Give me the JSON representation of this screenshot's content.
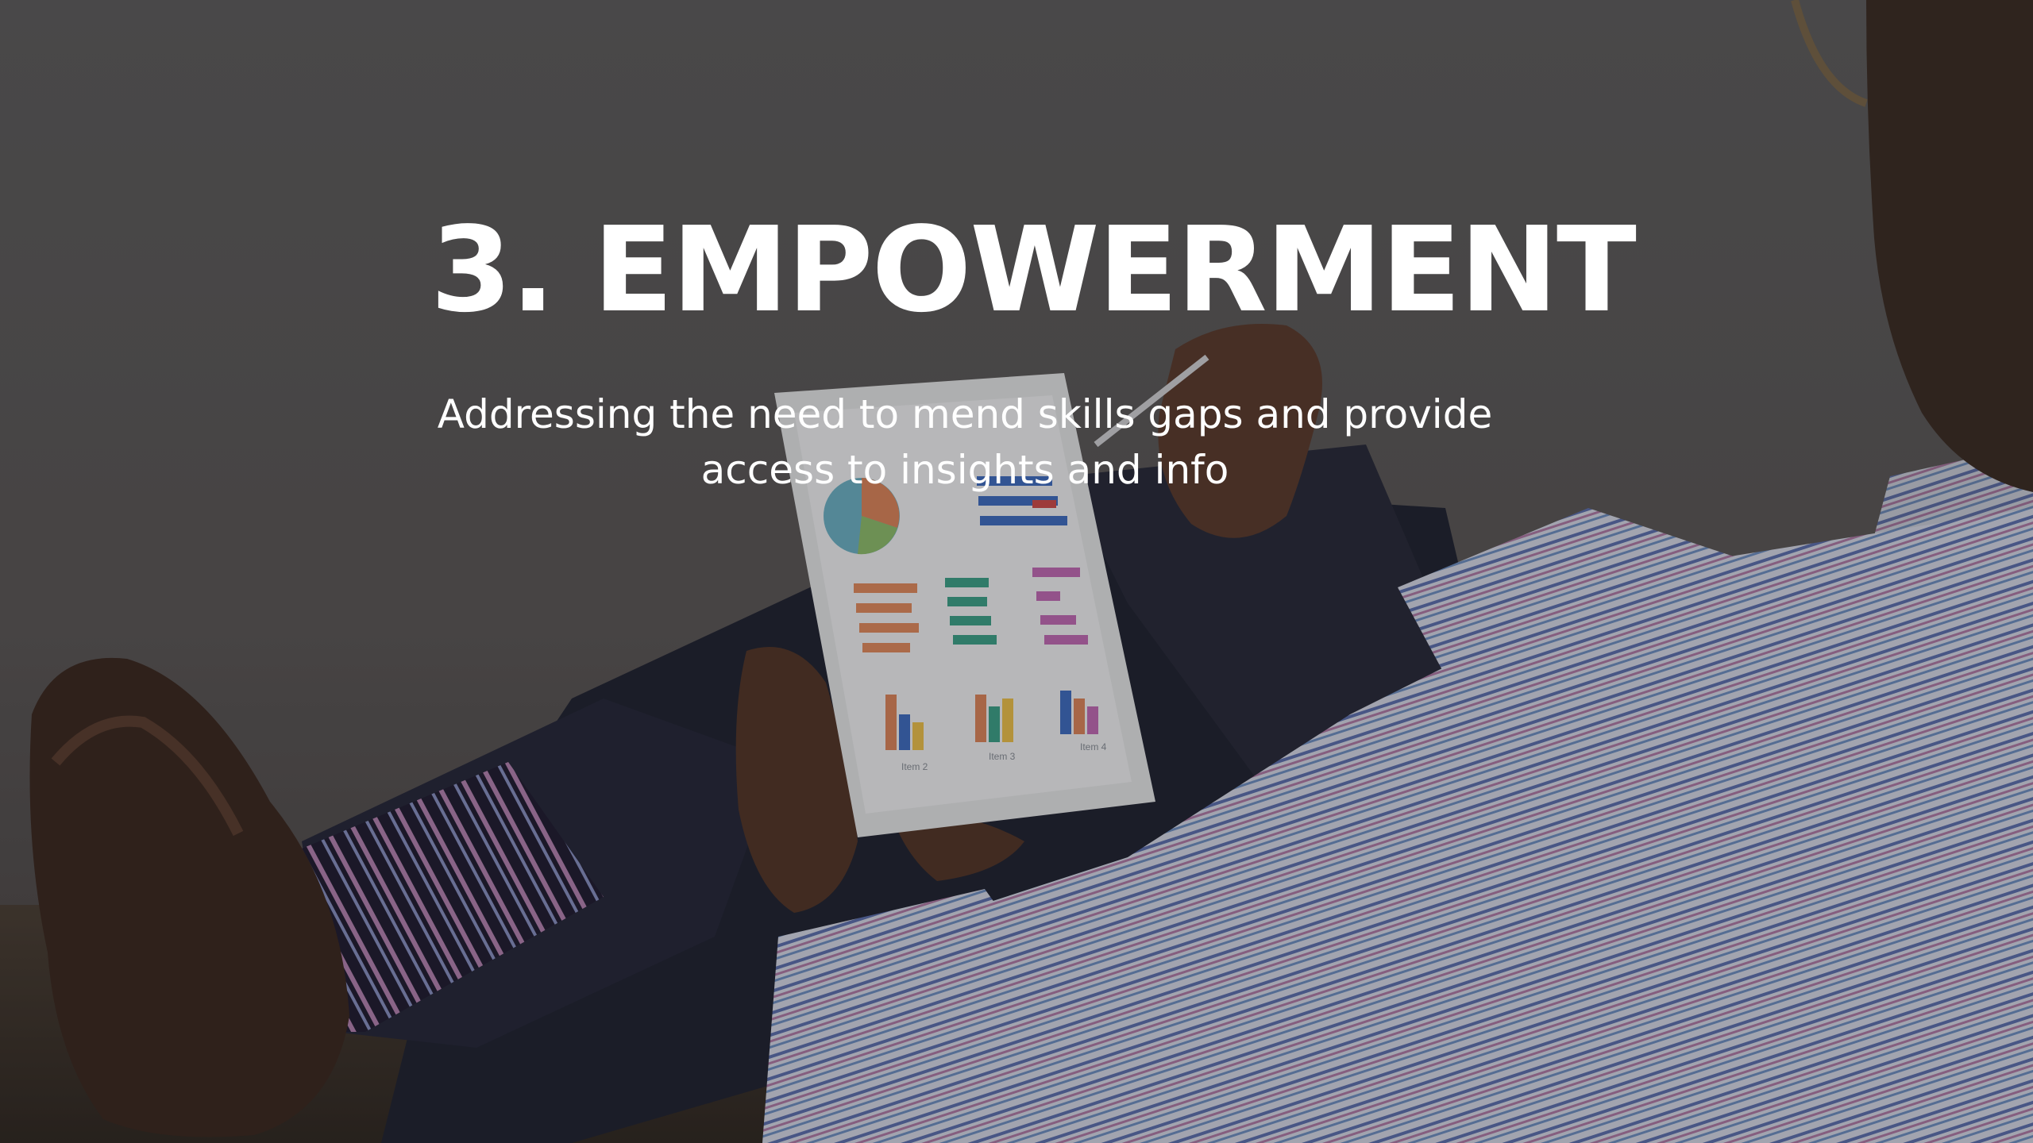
{
  "slide": {
    "title": "3. EMPOWERMENT",
    "subtitle": "Addressing the need to mend skills gaps and provide access to insights and info"
  },
  "background": {
    "description_icon": "photo-man-with-tablet-icon",
    "overlay_color": "#141416"
  },
  "tablet_chart": {
    "labels": [
      "Item 2",
      "Item 3",
      "Item 4"
    ]
  }
}
